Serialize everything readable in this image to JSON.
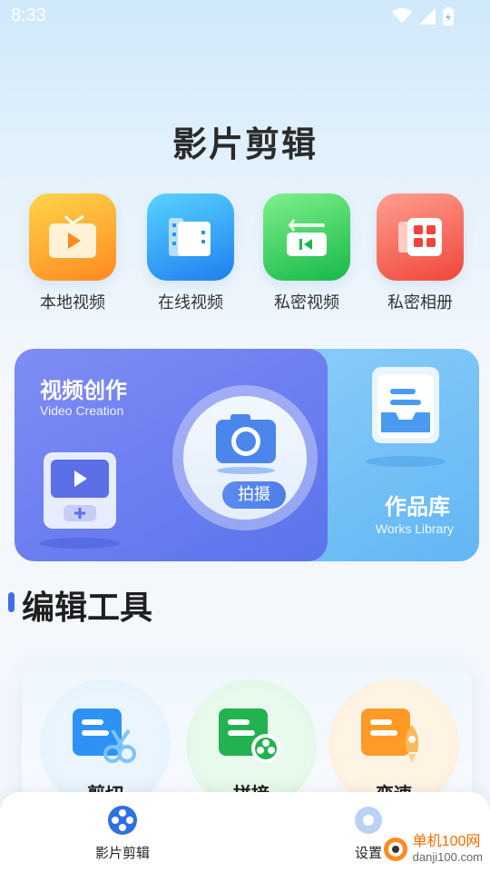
{
  "status_bar": {
    "time": "8:33",
    "icons": [
      "wifi-icon",
      "cell-signal-icon",
      "battery-icon"
    ]
  },
  "app_title": "影片剪辑",
  "shortcuts": [
    {
      "label": "本地视频",
      "icon": "tv-play-icon",
      "color": "#ff9a26"
    },
    {
      "label": "在线视频",
      "icon": "film-folder-icon",
      "color": "#2e92f5"
    },
    {
      "label": "私密视频",
      "icon": "private-video-icon",
      "color": "#22c456"
    },
    {
      "label": "私密相册",
      "icon": "album-grid-icon",
      "color": "#f4564a"
    }
  ],
  "banner": {
    "creation_cn": "视频创作",
    "creation_en": "Video Creation",
    "shoot_label": "拍摄",
    "works_cn": "作品库",
    "works_en": "Works Library"
  },
  "tools_section": {
    "title": "编辑工具",
    "tools": [
      {
        "label": "剪切",
        "icon": "scissors-icon",
        "color": "#2e92f5"
      },
      {
        "label": "拼接",
        "icon": "puzzle-icon",
        "color": "#22b24f"
      },
      {
        "label": "变速",
        "icon": "rocket-icon",
        "color": "#ff9a26"
      }
    ]
  },
  "bottom_nav": {
    "items": [
      {
        "label": "影片剪辑",
        "icon": "film-reel-icon",
        "active": true
      },
      {
        "label": "设置",
        "icon": "settings-icon",
        "active": false
      }
    ]
  },
  "watermark": {
    "brand": "单机100网",
    "url": "danji100.com"
  }
}
